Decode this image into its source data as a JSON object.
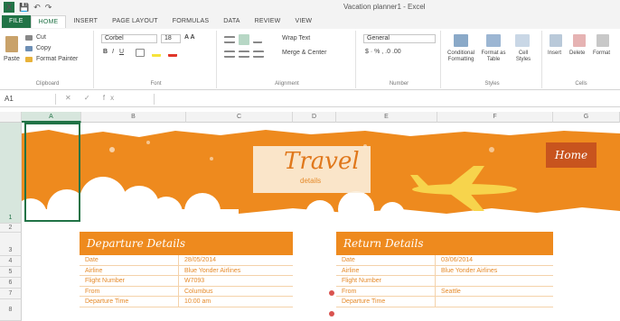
{
  "window": {
    "title": "Vacation planner1 - Excel",
    "app_icon": "X"
  },
  "quick_access": {
    "save_icon": "💾",
    "undo_icon": "↶",
    "redo_icon": "↷"
  },
  "tabs": [
    "FILE",
    "HOME",
    "INSERT",
    "PAGE LAYOUT",
    "FORMULAS",
    "DATA",
    "REVIEW",
    "VIEW"
  ],
  "ribbon": {
    "clipboard": {
      "paste": "Paste",
      "cut": "Cut",
      "copy": "Copy",
      "format_painter": "Format Painter",
      "group": "Clipboard"
    },
    "font": {
      "name": "Corbel",
      "size": "18",
      "group": "Font"
    },
    "alignment": {
      "wrap": "Wrap Text",
      "merge": "Merge & Center",
      "group": "Alignment"
    },
    "number": {
      "format": "General",
      "group": "Number"
    },
    "styles": {
      "conditional": "Conditional Formatting",
      "format_table": "Format as Table",
      "cell_styles": "Cell Styles",
      "group": "Styles"
    },
    "cells": {
      "insert": "Insert",
      "delete": "Delete",
      "format": "Format",
      "group": "Cells"
    }
  },
  "formula_bar": {
    "name_box": "A1",
    "fx": "✕ ✓ fx"
  },
  "columns": [
    "A",
    "B",
    "C",
    "D",
    "E",
    "F",
    "G"
  ],
  "rows": [
    "1",
    "2",
    "3",
    "4",
    "5",
    "6",
    "7",
    "8"
  ],
  "banner": {
    "title": "Travel",
    "subtitle": "details",
    "home_button": "Home",
    "colors": {
      "orange": "#ee8a1e",
      "dark_orange": "#c8541e",
      "yellow": "#f7d44c"
    }
  },
  "departure": {
    "title": "Departure Details",
    "rows": [
      {
        "label": "Date",
        "value": "28/05/2014"
      },
      {
        "label": "Airline",
        "value": "Blue Yonder Airlines"
      },
      {
        "label": "Flight Number",
        "value": "W7093"
      },
      {
        "label": "From",
        "value": "Columbus"
      },
      {
        "label": "Departure Time",
        "value": "10:00 am"
      }
    ]
  },
  "return": {
    "title": "Return Details",
    "rows": [
      {
        "label": "Date",
        "value": "03/06/2014"
      },
      {
        "label": "Airline",
        "value": "Blue Yonder Airlines"
      },
      {
        "label": "Flight Number",
        "value": ""
      },
      {
        "label": "From",
        "value": "Seattle"
      },
      {
        "label": "Departure Time",
        "value": ""
      }
    ]
  }
}
